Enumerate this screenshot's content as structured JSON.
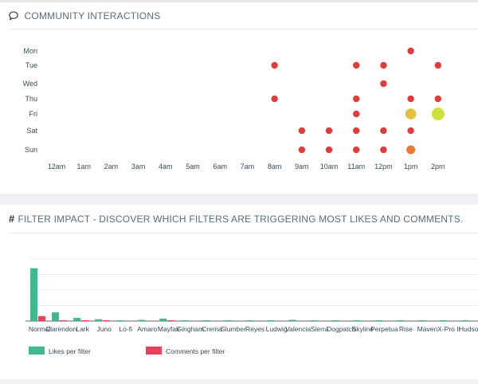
{
  "community": {
    "title": "COMMUNITY INTERACTIONS",
    "icon": "speech-bubble-icon"
  },
  "filters": {
    "title": "FILTER IMPACT - DISCOVER WHICH FILTERS ARE TRIGGERING MOST LIKES AND COMMENTS.",
    "icon": "hashtag-icon"
  },
  "chart_data": [
    {
      "type": "scatter",
      "title": "",
      "days": [
        "Mon",
        "Tue",
        "Wed",
        "Thu",
        "Fri",
        "Sat",
        "Sun"
      ],
      "hours": [
        "12am",
        "1am",
        "2am",
        "3am",
        "4am",
        "5am",
        "6am",
        "7am",
        "8am",
        "9am",
        "10am",
        "11am",
        "12pm",
        "1pm",
        "2pm"
      ],
      "points": [
        {
          "day": "Mon",
          "hour": "1pm",
          "level": "low"
        },
        {
          "day": "Tue",
          "hour": "8am",
          "level": "low"
        },
        {
          "day": "Tue",
          "hour": "11am",
          "level": "low"
        },
        {
          "day": "Tue",
          "hour": "12pm",
          "level": "low"
        },
        {
          "day": "Tue",
          "hour": "2pm",
          "level": "low"
        },
        {
          "day": "Wed",
          "hour": "12pm",
          "level": "low"
        },
        {
          "day": "Thu",
          "hour": "8am",
          "level": "low"
        },
        {
          "day": "Thu",
          "hour": "11am",
          "level": "low"
        },
        {
          "day": "Thu",
          "hour": "1pm",
          "level": "low"
        },
        {
          "day": "Thu",
          "hour": "2pm",
          "level": "low"
        },
        {
          "day": "Fri",
          "hour": "11am",
          "level": "low"
        },
        {
          "day": "Fri",
          "hour": "1pm",
          "level": "high"
        },
        {
          "day": "Fri",
          "hour": "2pm",
          "level": "max"
        },
        {
          "day": "Sat",
          "hour": "9am",
          "level": "low"
        },
        {
          "day": "Sat",
          "hour": "10am",
          "level": "low"
        },
        {
          "day": "Sat",
          "hour": "11am",
          "level": "low"
        },
        {
          "day": "Sat",
          "hour": "12pm",
          "level": "low"
        },
        {
          "day": "Sat",
          "hour": "1pm",
          "level": "low"
        },
        {
          "day": "Sun",
          "hour": "9am",
          "level": "low"
        },
        {
          "day": "Sun",
          "hour": "10am",
          "level": "low"
        },
        {
          "day": "Sun",
          "hour": "11am",
          "level": "low"
        },
        {
          "day": "Sun",
          "hour": "12pm",
          "level": "low"
        },
        {
          "day": "Sun",
          "hour": "1pm",
          "level": "mid"
        }
      ],
      "level_colors": {
        "low": "#e03c3c",
        "mid": "#e8793a",
        "high": "#e6c03a",
        "max": "#cfe03a"
      }
    },
    {
      "type": "bar",
      "title": "",
      "categories": [
        "Normal",
        "Clarendon",
        "Lark",
        "Juno",
        "Lo-fi",
        "Amaro",
        "Mayfair",
        "Gingham",
        "Crema",
        "Slumber",
        "Reyes",
        "Ludwig",
        "Valencia",
        "Sierra",
        "Dogpatch",
        "Skyline",
        "Perpetua",
        "Rise",
        "Maven",
        "X-Pro II",
        "Hudson"
      ],
      "ylim": [
        0,
        100
      ],
      "series": [
        {
          "name": "Likes per filter",
          "color": "#3fba8e",
          "values": [
            85,
            14,
            5,
            3,
            1,
            2,
            4,
            1,
            1,
            1,
            0.5,
            1,
            2,
            0.5,
            0.5,
            0.5,
            0.5,
            0.5,
            0.5,
            1,
            1
          ]
        },
        {
          "name": "Comments per filter",
          "color": "#e8435a",
          "values": [
            8,
            1,
            0.5,
            0.5,
            0,
            0,
            0.5,
            0,
            0,
            0,
            0,
            0,
            0,
            0,
            0,
            0,
            0,
            0,
            0,
            0,
            0
          ]
        }
      ]
    }
  ]
}
